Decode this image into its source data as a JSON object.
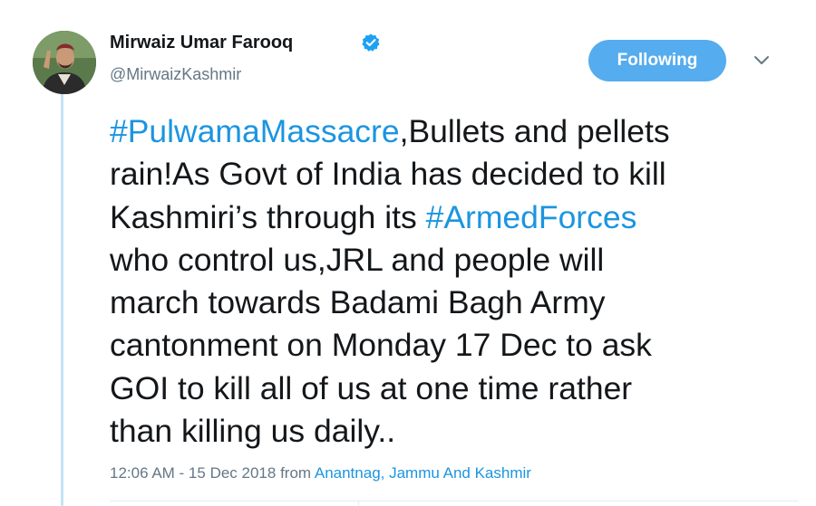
{
  "author": {
    "display_name": "Mirwaiz Umar Farooq",
    "handle": "@MirwaizKashmir",
    "verified_icon": "verified-badge-icon",
    "avatar_icon": "profile-photo"
  },
  "follow_button": {
    "label": "Following"
  },
  "menu": {
    "icon": "chevron-down-icon"
  },
  "tweet": {
    "line1": {
      "hashtag": "#PulwamaMassacre",
      "text": ",Bullets and pellets"
    },
    "line2": "rain!As Govt of India has decided to kill",
    "line3": {
      "text": "Kashmiri’s through its ",
      "hashtag": "#ArmedForces"
    },
    "line4": "who control us,JRL and people will",
    "line5": "march towards Badami Bagh Army",
    "line6": "cantonment on Monday 17 Dec to ask",
    "line7": "GOI to kill all of us at one time rather",
    "line8": "than killing us daily.."
  },
  "meta": {
    "timestamp": "12:06 AM - 15 Dec 2018",
    "from_label": " from ",
    "location": "Anantnag, Jammu And Kashmir"
  },
  "colors": {
    "link": "#1b95e0",
    "button": "#55acee",
    "secondary_text": "#657786",
    "thread_line": "#c4e3f5"
  }
}
